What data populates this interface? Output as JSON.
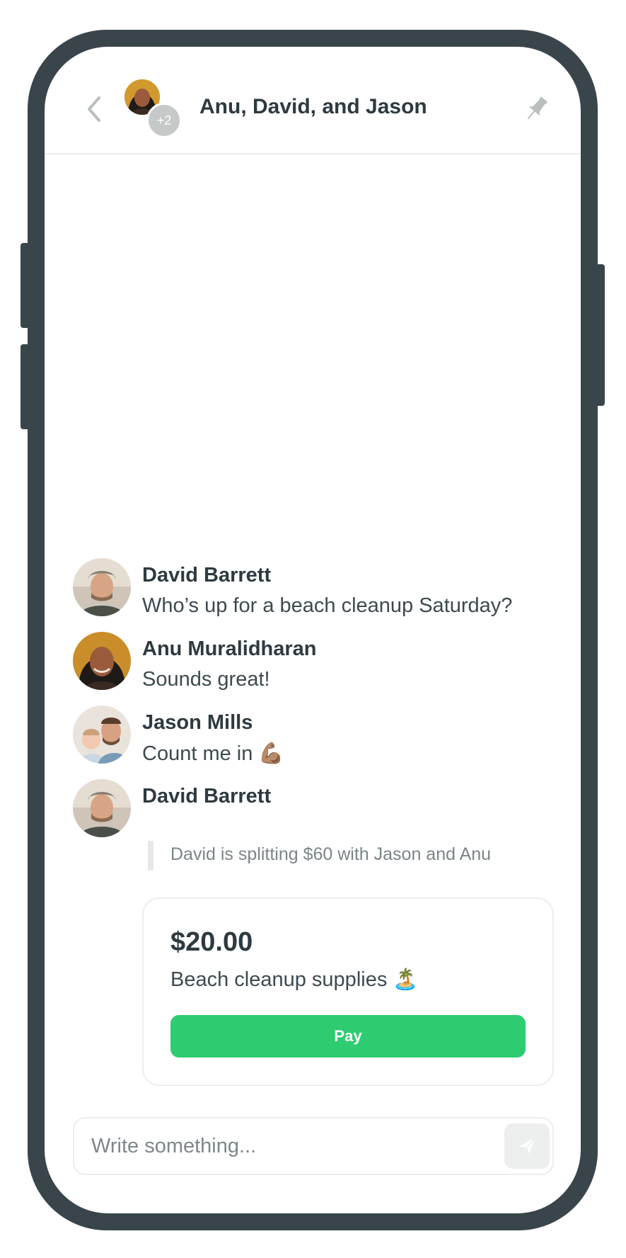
{
  "header": {
    "title": "Anu, David, and Jason",
    "participant_overflow": "+2",
    "back_icon": "chevron-left-icon",
    "pin_icon": "pin-icon"
  },
  "messages": [
    {
      "sender": "David Barrett",
      "text": "Who’s up for a beach cleanup Saturday?",
      "emoji": ""
    },
    {
      "sender": "Anu Muralidharan",
      "text": "Sounds great!",
      "emoji": ""
    },
    {
      "sender": "Jason Mills",
      "text": "Count me in",
      "emoji": "💪🏽"
    },
    {
      "sender": "David Barrett",
      "text": "",
      "emoji": ""
    }
  ],
  "split_request": {
    "description": "David is splitting $60 with Jason and Anu",
    "amount": "$20.00",
    "note": "Beach cleanup supplies",
    "note_emoji": "🏝️",
    "pay_label": "Pay"
  },
  "composer": {
    "placeholder": "Write something...",
    "send_icon": "send-icon"
  },
  "colors": {
    "frame": "#39454b",
    "pay_button": "#2ecc71",
    "text_primary": "#2e3a40",
    "text_secondary": "#7b8589"
  }
}
